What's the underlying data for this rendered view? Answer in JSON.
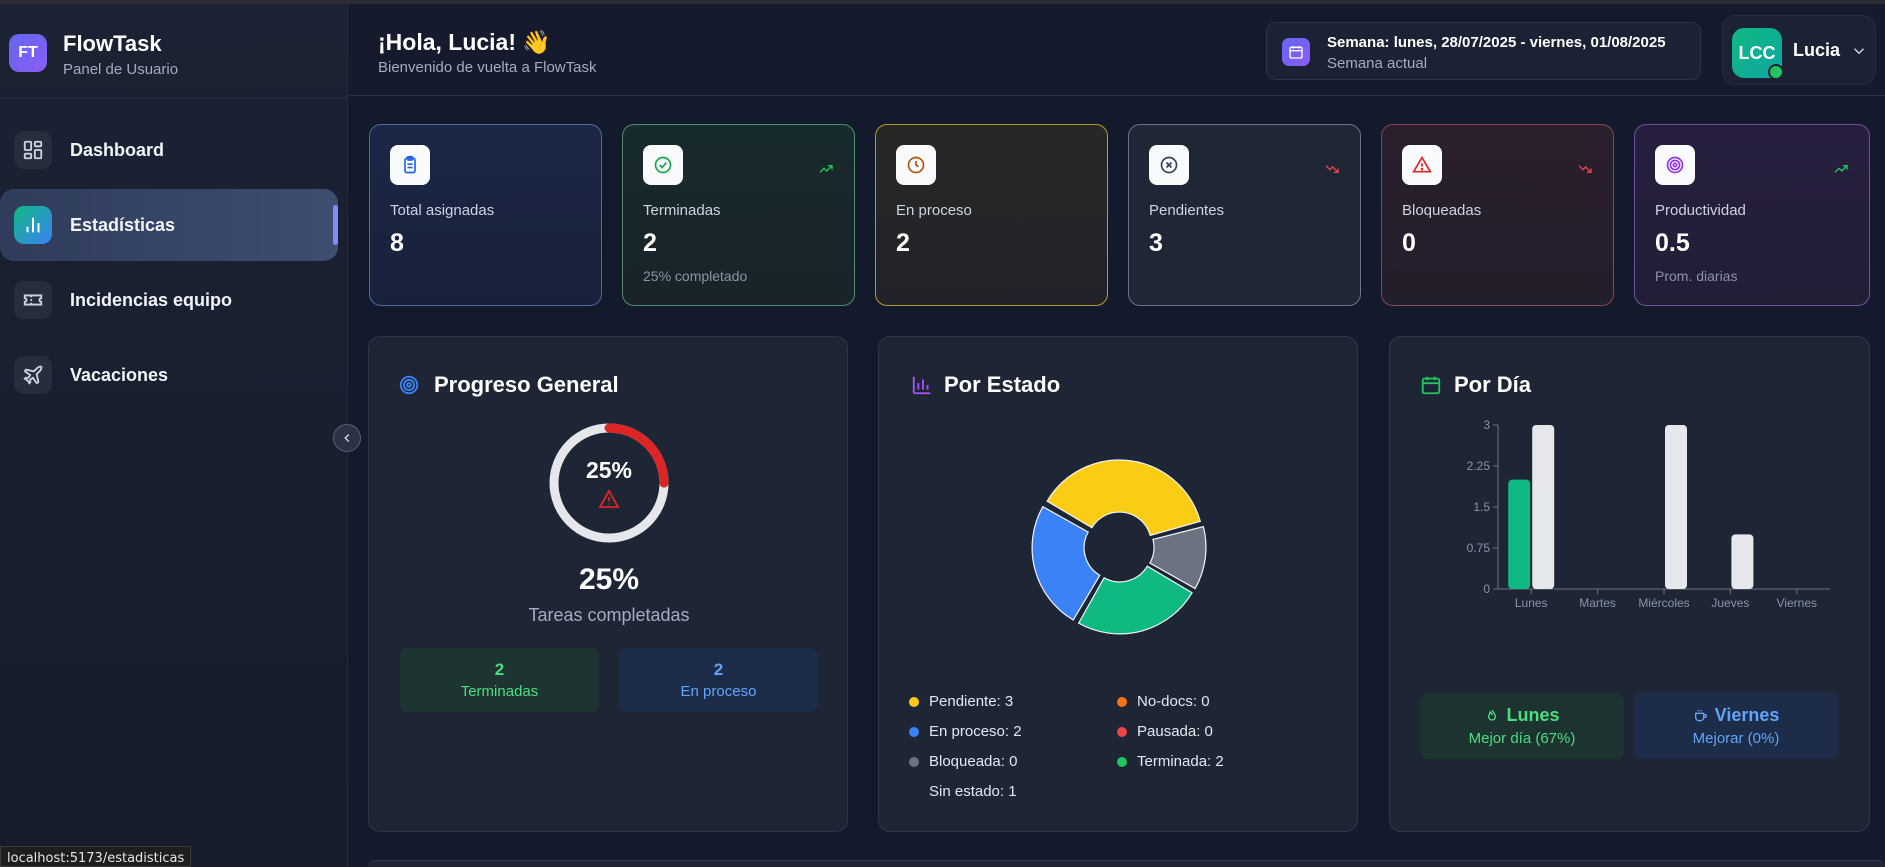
{
  "brand": {
    "logo": "FT",
    "name": "FlowTask",
    "subtitle": "Panel de Usuario"
  },
  "nav": [
    {
      "label": "Dashboard",
      "icon": "grid-icon",
      "active": false
    },
    {
      "label": "Estadísticas",
      "icon": "bar-chart-icon",
      "active": true
    },
    {
      "label": "Incidencias equipo",
      "icon": "ticket-icon",
      "active": false
    },
    {
      "label": "Vacaciones",
      "icon": "plane-icon",
      "active": false
    }
  ],
  "status_url": "localhost:5173/estadisticas",
  "header": {
    "greeting": "¡Hola, Lucia! 👋",
    "welcome": "Bienvenido de vuelta a FlowTask",
    "week_range": "Semana: lunes, 28/07/2025 - viernes, 01/08/2025",
    "week_label": "Semana actual",
    "user_initials": "LCC",
    "user_name": "Lucia"
  },
  "stats": [
    {
      "label": "Total asignadas",
      "value": "8",
      "sub": "",
      "icon": "clipboard-icon",
      "trend": "",
      "accent": "#3b82f6"
    },
    {
      "label": "Terminadas",
      "value": "2",
      "sub": "25% completado",
      "icon": "check-circle-icon",
      "trend": "up",
      "accent": "#22c55e"
    },
    {
      "label": "En proceso",
      "value": "2",
      "sub": "",
      "icon": "clock-icon",
      "trend": "",
      "accent": "#eab308"
    },
    {
      "label": "Pendientes",
      "value": "3",
      "sub": "",
      "icon": "x-circle-icon",
      "trend": "down",
      "accent": "#64748b"
    },
    {
      "label": "Bloqueadas",
      "value": "0",
      "sub": "",
      "icon": "alert-triangle-icon",
      "trend": "down",
      "accent": "#ef4444"
    },
    {
      "label": "Productividad",
      "value": "0.5",
      "sub": "Prom. diarias",
      "icon": "target-icon",
      "trend": "up",
      "accent": "#a855f7"
    }
  ],
  "progress": {
    "title": "Progreso General",
    "percent": 25,
    "percent_text": "25%",
    "caption": "Tareas completadas",
    "done_value": "2",
    "done_label": "Terminadas",
    "inprog_value": "2",
    "inprog_label": "En proceso"
  },
  "status_panel": {
    "title": "Por Estado",
    "legend": [
      {
        "text": "Pendiente: 3",
        "color": "#facc15"
      },
      {
        "text": "No-docs: 0",
        "color": "#f97316"
      },
      {
        "text": "En proceso: 2",
        "color": "#3b82f6"
      },
      {
        "text": "Pausada: 0",
        "color": "#ef4444"
      },
      {
        "text": "Bloqueada: 0",
        "color": "#6b7280"
      },
      {
        "text": "Terminada: 2",
        "color": "#22c55e"
      },
      {
        "text": "Sin estado: 1",
        "color": ""
      }
    ]
  },
  "day_panel": {
    "title": "Por Día",
    "best_day": "Lunes",
    "best_label": "Mejor día (67%)",
    "worst_day": "Viernes",
    "worst_label": "Mejorar (0%)"
  },
  "chart_data": [
    {
      "type": "pie",
      "title": "Por Estado",
      "categories": [
        "Pendiente",
        "Sin estado",
        "Terminada",
        "En proceso"
      ],
      "values": [
        3,
        1,
        2,
        2
      ],
      "colors": [
        "#facc15",
        "#6b7280",
        "#10b981",
        "#3b82f6"
      ]
    },
    {
      "type": "bar",
      "title": "Por Día",
      "categories": [
        "Lunes",
        "Martes",
        "Miércoles",
        "Jueves",
        "Viernes"
      ],
      "series": [
        {
          "values": [
            2,
            0,
            0,
            0,
            0
          ],
          "color": "#10b981"
        },
        {
          "values": [
            3,
            0,
            3,
            1,
            0
          ],
          "color": "#e5e7eb"
        }
      ],
      "ylim": [
        0,
        3
      ],
      "yticks": [
        "0",
        "0.75",
        "1.5",
        "2.25",
        "3"
      ]
    }
  ]
}
